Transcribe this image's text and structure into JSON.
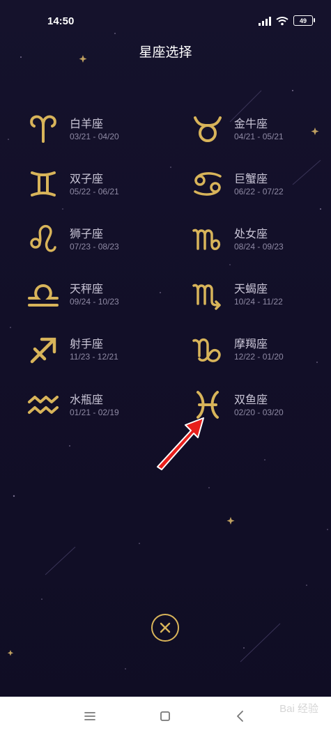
{
  "status_bar": {
    "time": "14:50",
    "battery": "49"
  },
  "page_title": "星座选择",
  "zodiac_signs": [
    {
      "name": "白羊座",
      "dates": "03/21 - 04/20",
      "icon": "aries-icon"
    },
    {
      "name": "金牛座",
      "dates": "04/21 - 05/21",
      "icon": "taurus-icon"
    },
    {
      "name": "双子座",
      "dates": "05/22 - 06/21",
      "icon": "gemini-icon"
    },
    {
      "name": "巨蟹座",
      "dates": "06/22 - 07/22",
      "icon": "cancer-icon"
    },
    {
      "name": "狮子座",
      "dates": "07/23 - 08/23",
      "icon": "leo-icon"
    },
    {
      "name": "处女座",
      "dates": "08/24 - 09/23",
      "icon": "virgo-icon"
    },
    {
      "name": "天秤座",
      "dates": "09/24 - 10/23",
      "icon": "libra-icon"
    },
    {
      "name": "天蝎座",
      "dates": "10/24 - 11/22",
      "icon": "scorpio-icon"
    },
    {
      "name": "射手座",
      "dates": "11/23 - 12/21",
      "icon": "sagittarius-icon"
    },
    {
      "name": "摩羯座",
      "dates": "12/22 - 01/20",
      "icon": "capricorn-icon"
    },
    {
      "name": "水瓶座",
      "dates": "01/21 - 02/19",
      "icon": "aquarius-icon"
    },
    {
      "name": "双鱼座",
      "dates": "02/20 - 03/20",
      "icon": "pisces-icon"
    }
  ],
  "annotation": {
    "icon": "red-arrow-icon",
    "color": "#e8201c"
  },
  "close_button": {
    "icon": "close-icon"
  },
  "nav_bar": {
    "buttons": [
      "menu-icon",
      "home-icon",
      "back-icon"
    ]
  },
  "watermark": "Bai 经验",
  "colors": {
    "background": "#14112a",
    "gold": "#d8b45a",
    "name_text": "#c9c5d6",
    "date_text": "#8f8aa4"
  }
}
